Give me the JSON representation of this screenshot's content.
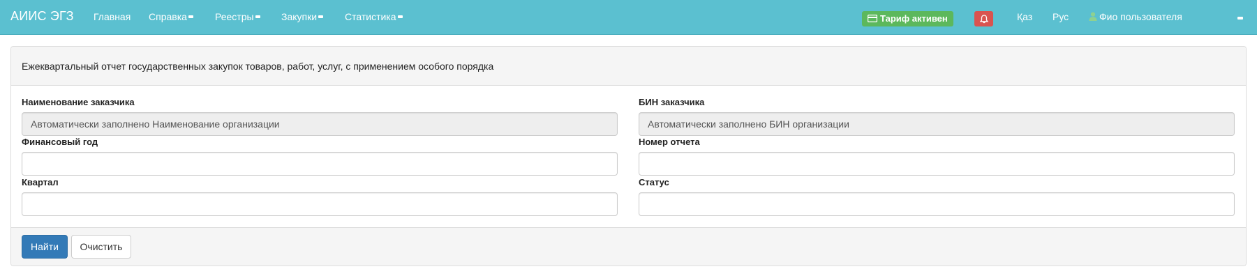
{
  "navbar": {
    "brand": "АИИС ЭГЗ",
    "items": [
      {
        "label": "Главная"
      },
      {
        "label": "Справка"
      },
      {
        "label": "Реестры"
      },
      {
        "label": "Закупки"
      },
      {
        "label": "Статистика"
      }
    ],
    "tariff_label": "Тариф активен",
    "lang_kz": "Қаз",
    "lang_ru": "Рус",
    "user_name": "Фио пользователя",
    "icons": [
      "credit-card-icon",
      "bell-icon",
      "user-icon",
      "caret-down-icon"
    ],
    "colors": {
      "navbar_bg": "#5bc0d0",
      "tariff_bg": "#5cb85c",
      "bell_bg": "#d9534f"
    }
  },
  "panel": {
    "title": "Ежеквартальный отчет государственных закупок товаров, работ, услуг, с применением особого порядка",
    "fields": {
      "customer_name": {
        "label": "Наименование заказчика",
        "value": "Автоматически заполнено Наименование организации"
      },
      "customer_bin": {
        "label": "БИН заказчика",
        "value": "Автоматически заполнено БИН организации"
      },
      "fiscal_year": {
        "label": "Финансовый год",
        "value": ""
      },
      "report_number": {
        "label": "Номер отчета",
        "value": ""
      },
      "quarter": {
        "label": "Квартал",
        "value": ""
      },
      "status": {
        "label": "Статус",
        "value": ""
      }
    },
    "buttons": {
      "search": "Найти",
      "clear": "Очистить"
    },
    "colors": {
      "primary": "#337ab7"
    }
  }
}
